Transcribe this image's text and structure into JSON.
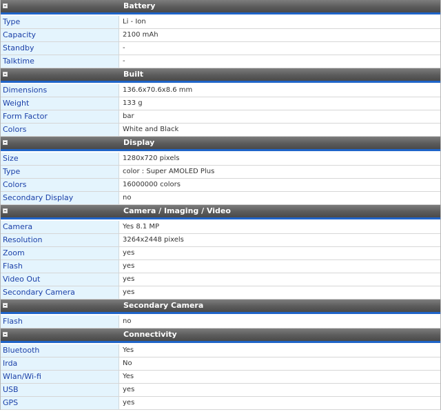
{
  "sections": [
    {
      "title": "Battery",
      "rows": [
        {
          "label": "Type",
          "value": "Li - Ion"
        },
        {
          "label": "Capacity",
          "value": "2100 mAh"
        },
        {
          "label": "Standby",
          "value": "-"
        },
        {
          "label": "Talktime",
          "value": "-"
        }
      ]
    },
    {
      "title": "Built",
      "rows": [
        {
          "label": "Dimensions",
          "value": "136.6x70.6x8.6 mm"
        },
        {
          "label": "Weight",
          "value": "133 g"
        },
        {
          "label": "Form Factor",
          "value": "bar"
        },
        {
          "label": "Colors",
          "value": "White and Black"
        }
      ]
    },
    {
      "title": "Display",
      "rows": [
        {
          "label": "Size",
          "value": "1280x720 pixels"
        },
        {
          "label": "Type",
          "value": "color : Super AMOLED Plus"
        },
        {
          "label": "Colors",
          "value": "16000000 colors"
        },
        {
          "label": "Secondary Display",
          "value": "no"
        }
      ]
    },
    {
      "title": "Camera / Imaging / Video",
      "rows": [
        {
          "label": "Camera",
          "value": "Yes 8.1 MP"
        },
        {
          "label": "Resolution",
          "value": "3264x2448 pixels"
        },
        {
          "label": "Zoom",
          "value": "yes"
        },
        {
          "label": "Flash",
          "value": "yes"
        },
        {
          "label": "Video Out",
          "value": "yes"
        },
        {
          "label": "Secondary Camera",
          "value": "yes"
        }
      ]
    },
    {
      "title": "Secondary Camera",
      "rows": [
        {
          "label": "Flash",
          "value": "no"
        }
      ]
    },
    {
      "title": "Connectivity",
      "rows": [
        {
          "label": "Bluetooth",
          "value": "Yes"
        },
        {
          "label": "Irda",
          "value": "No"
        },
        {
          "label": "Wlan/Wi-fi",
          "value": "Yes"
        },
        {
          "label": "USB",
          "value": "yes"
        },
        {
          "label": "GPS",
          "value": "yes"
        }
      ]
    }
  ]
}
